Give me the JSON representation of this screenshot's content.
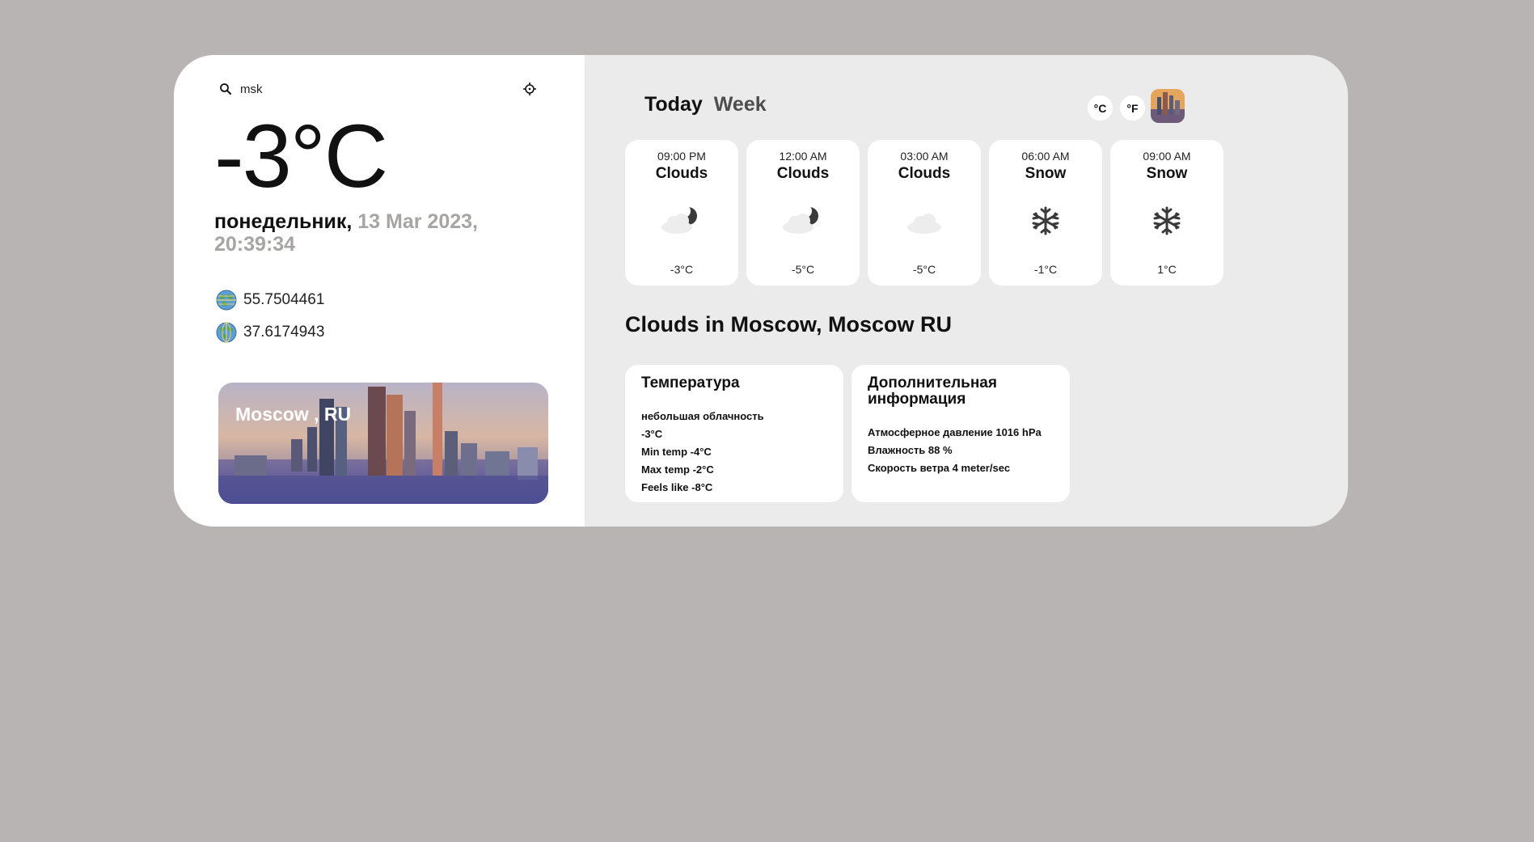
{
  "search": {
    "value": "msk",
    "placeholder": ""
  },
  "current": {
    "temperature": "-3°C",
    "day": "понедельник,",
    "datetime": " 13 Mar 2023, 20:39:34",
    "latitude": "55.7504461",
    "longitude": "37.6174943"
  },
  "city_card": {
    "name": "Moscow , RU"
  },
  "tabs": [
    {
      "label": "Today",
      "active": true
    },
    {
      "label": "Week",
      "active": false
    }
  ],
  "units": {
    "celsius": "°C",
    "fahrenheit": "°F"
  },
  "forecast": [
    {
      "time": "09:00 PM",
      "desc": "Clouds",
      "icon": "partly-cloudy-night-icon",
      "temp": "-3°C"
    },
    {
      "time": "12:00 AM",
      "desc": "Clouds",
      "icon": "partly-cloudy-night-icon",
      "temp": "-5°C"
    },
    {
      "time": "03:00 AM",
      "desc": "Clouds",
      "icon": "cloud-icon",
      "temp": "-5°C"
    },
    {
      "time": "06:00 AM",
      "desc": "Snow",
      "icon": "snowflake-icon",
      "temp": "-1°C"
    },
    {
      "time": "09:00 AM",
      "desc": "Snow",
      "icon": "snowflake-icon",
      "temp": "1°C"
    }
  ],
  "headline": "Clouds in Moscow, Moscow RU",
  "temperature_card": {
    "title": "Температура",
    "lines": [
      "небольшая облачность",
      "-3°C",
      "Min temp -4°C",
      "Max temp -2°C",
      "Feels like -8°C"
    ]
  },
  "extra_card": {
    "title": "Дополнительная информация",
    "lines": [
      "Атмосферное давление 1016 hPa",
      "Влажность 88 %",
      "Скорость ветра 4 meter/sec"
    ]
  },
  "colors": {
    "background": "#b8b4b3",
    "panel_left": "#ffffff",
    "panel_right": "#ebebeb",
    "muted_text": "#a7a4a4"
  }
}
